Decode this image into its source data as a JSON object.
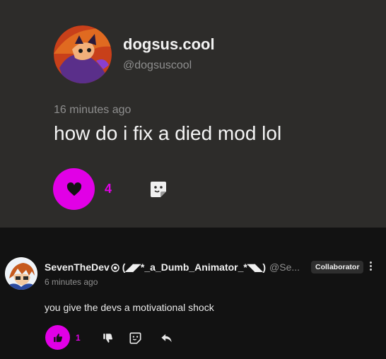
{
  "post": {
    "author": "dogsus.cool",
    "handle": "@dogsuscool",
    "time": "16 minutes ago",
    "text": "how do i fix a died mod lol",
    "like_count": "4",
    "icons": {
      "like": "heart-icon",
      "share": "sticker-icon"
    }
  },
  "comment": {
    "author": "SevenTheDev",
    "author_suffix": " (◢◤*_a_Dumb_Animator_*◥◣)",
    "handle": "@Se...",
    "badge": "Collaborator",
    "time": "6 minutes ago",
    "text": "you give the devs a motivational shock",
    "like_count": "1",
    "icons": {
      "like": "thumbs-up-icon",
      "dislike": "thumbs-down-icon",
      "sticker": "sticker-icon",
      "reply": "reply-icon",
      "more": "kebab-menu-icon"
    }
  },
  "colors": {
    "accent": "#e100e6",
    "post_bg": "#2d2c2a",
    "comment_bg": "#121212",
    "muted_text": "#8e8e8e"
  }
}
